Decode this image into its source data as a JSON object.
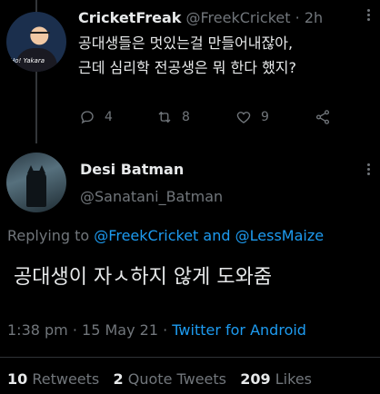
{
  "parent_tweet": {
    "display_name": "CricketFreak",
    "handle": "@FreekCricket",
    "separator": "·",
    "time": "2h",
    "avatar_caption": "Ho! Yakara",
    "lines": [
      "공대생들은 멋있는걸 만들어내잖아,",
      "근데 심리학 전공생은 뭐 한다 했지?"
    ],
    "actions": {
      "replies": "4",
      "retweets": "8",
      "likes": "9"
    }
  },
  "main_tweet": {
    "display_name": "Desi Batman",
    "handle": "@Sanatani_Batman",
    "replying_prefix": "Replying to",
    "mention_1": "@FreekCricket",
    "replying_and": "and",
    "mention_2": "@LessMaize",
    "text": "공대생이 자ㅅ하지 않게 도와줌",
    "time": "1:38 pm",
    "date_sep": "·",
    "date": "15 May 21",
    "source_sep": "·",
    "source": "Twitter for Android"
  },
  "stats": {
    "retweets_count": "10",
    "retweets_label": "Retweets",
    "quotes_count": "2",
    "quotes_label": "Quote Tweets",
    "likes_count": "209",
    "likes_label": "Likes"
  },
  "colors": {
    "background": "#000000",
    "text": "#e7e9ea",
    "muted": "#71767b",
    "link": "#1d9bf0"
  },
  "icons": [
    "reply-icon",
    "retweet-icon",
    "like-icon",
    "share-icon",
    "more-icon"
  ]
}
